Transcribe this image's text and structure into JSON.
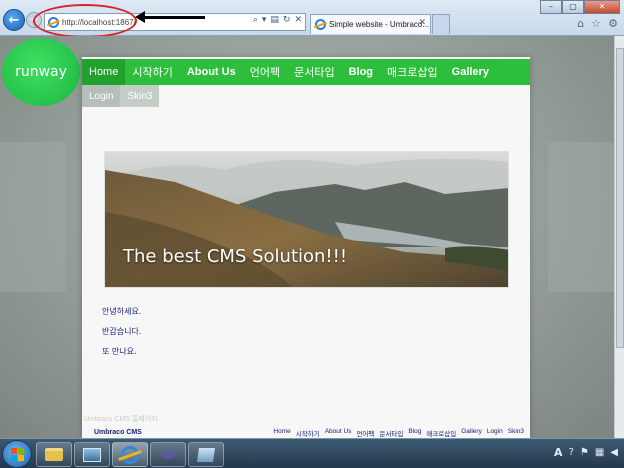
{
  "browser": {
    "address_url": "http://localhost:1867/",
    "tab_title": "Simple website - Umbraco...",
    "tab_close": "✕",
    "back_icon": "back-arrow-icon",
    "forward_icon": "forward-arrow-icon",
    "address_icons": [
      "search-icon",
      "dropdown-icon",
      "compatibility-icon",
      "refresh-icon",
      "stop-icon"
    ],
    "window_buttons": [
      "–",
      "▢",
      "✕"
    ],
    "toolbar_icons": [
      "home-icon",
      "favorites-star-icon",
      "tools-gear-icon"
    ],
    "symbols": {
      "back": "←",
      "forward": "→",
      "search": "⌕",
      "dropdown": "▾",
      "refresh": "↻",
      "stop": "✕",
      "home": "⌂",
      "star": "☆",
      "gear": "⚙"
    }
  },
  "annotation": {
    "circle_color": "#d8232a",
    "arrow_color": "#000000"
  },
  "site": {
    "logo_text": "runway",
    "nav": [
      {
        "label": "Home",
        "active": true
      },
      {
        "label": "시작하기"
      },
      {
        "label": "About Us",
        "bold": true
      },
      {
        "label": "언어팩"
      },
      {
        "label": "문서타입"
      },
      {
        "label": "Blog",
        "bold": true
      },
      {
        "label": "매크로삽입"
      },
      {
        "label": "Gallery",
        "bold": true
      }
    ],
    "nav_row2": [
      {
        "label": "Login"
      },
      {
        "label": "Skin3"
      }
    ],
    "hero_caption": "The best CMS Solution!!!",
    "body_lines": [
      "안녕하세요.",
      "반갑습니다.",
      "또 만나요."
    ],
    "footer_hint": "Umbraco CMS 홈페이지",
    "footer_brand": "Umbraco CMS",
    "footer_links": [
      "Home",
      "시작하기",
      "About Us",
      "언어팩",
      "문서타입",
      "Blog",
      "매크로삽입",
      "Gallery",
      "Login",
      "Skin3"
    ],
    "colors": {
      "nav_green": "#2dbf3b",
      "nav_active": "#21a22c",
      "link_blue": "#1a237e",
      "logo_green": "#1bb440"
    }
  },
  "taskbar": {
    "items": [
      "start-orb-icon",
      "explorer-folder-icon",
      "remote-desktop-icon",
      "internet-explorer-icon",
      "visual-studio-icon",
      "document-icon"
    ],
    "active_item": "internet-explorer-icon",
    "tray_language": "A",
    "tray_icons": [
      "help-icon",
      "flag-icon",
      "network-icon",
      "volume-icon"
    ],
    "symbols": {
      "vs": "∞",
      "help": "?",
      "flag": "⚑",
      "network": "▦",
      "volume": "◀"
    }
  }
}
